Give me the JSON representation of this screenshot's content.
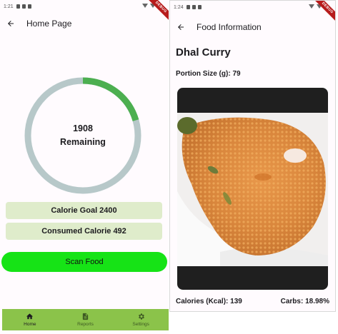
{
  "left_screen": {
    "status_time": "1:21",
    "debug_banner": "DEBUG",
    "title": "Home Page",
    "ring": {
      "remaining_value": "1908",
      "remaining_label": "Remaining",
      "consumed_fraction": 0.205,
      "progress_color": "#4caf50",
      "track_color": "#b7c8c9"
    },
    "calorie_goal": "Calorie Goal 2400",
    "consumed": "Consumed Calorie 492",
    "scan_button": "Scan Food",
    "bottom_nav": [
      {
        "label": "Home",
        "icon": "home-icon",
        "active": true
      },
      {
        "label": "Reports",
        "icon": "document-icon",
        "active": false
      },
      {
        "label": "Settings",
        "icon": "gear-icon",
        "active": false
      }
    ],
    "nav_color": "#8bc34a",
    "scan_color": "#16e316",
    "info_box_color": "#dfeccb"
  },
  "right_screen": {
    "status_time": "1:24",
    "debug_banner": "DEBUG",
    "title": "Food Information",
    "food_name": "Dhal Curry",
    "portion": "Portion Size (g): 79",
    "photo": "dhal-curry-with-rice-photo",
    "calories": "Calories (Kcal): 139",
    "carbs": "Carbs: 18.98%"
  }
}
